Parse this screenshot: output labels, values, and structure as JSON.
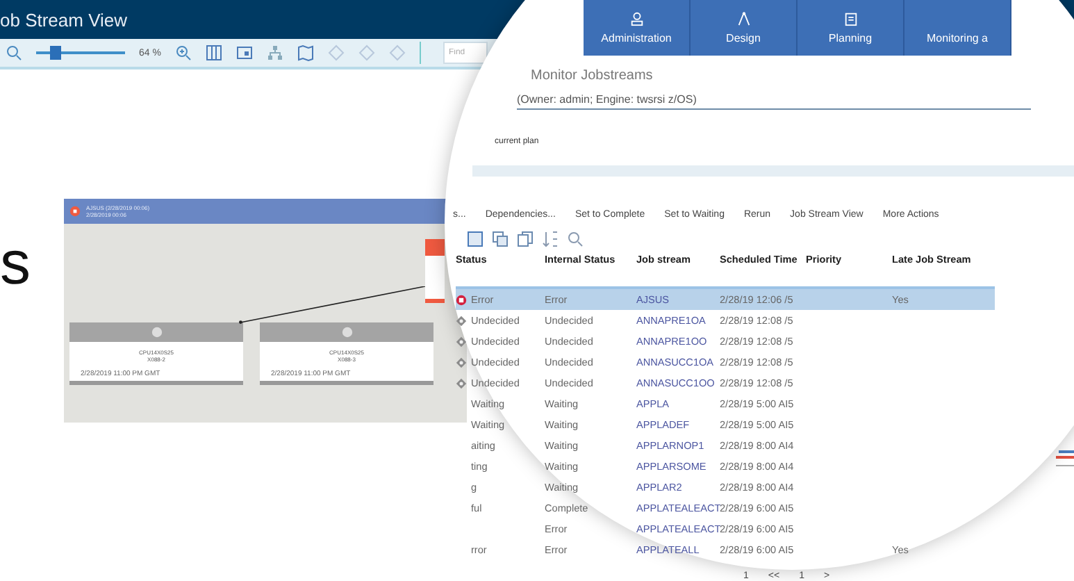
{
  "header": {
    "title": "ob Stream View"
  },
  "toolbar": {
    "zoom_reading": "64 %",
    "zoom": {
      "level": 0.22
    },
    "find": {
      "placeholder": "Find"
    }
  },
  "side_text": "s",
  "graph": {
    "title": "AJSUS (2/28/2019 00:06)",
    "subtitle": "2/28/2019 00:06",
    "nodes": [
      {
        "name": "CPU14X0S25",
        "job": "X088-2",
        "time": "2/28/2019 11:00 PM GMT"
      },
      {
        "name": "CPU14X0S25",
        "job": "X088-3",
        "time": "2/28/2019 11:00 PM GMT"
      }
    ]
  },
  "magnifier": {
    "nav_tabs": [
      {
        "label": "Administration"
      },
      {
        "label": "Design"
      },
      {
        "label": "Planning"
      },
      {
        "label": "Monitoring a"
      }
    ],
    "title": "Monitor Jobstreams",
    "subtitle": "(Owner: admin; Engine: twsrsi z/OS)",
    "plan": "current plan",
    "actions": [
      "s...",
      "Dependencies...",
      "Set to Complete",
      "Set to Waiting",
      "Rerun",
      "Job Stream View",
      "More Actions"
    ],
    "columns": [
      "Status",
      "Internal Status",
      "Job stream",
      "Scheduled Time",
      "Priority",
      "Late Job Stream"
    ],
    "rows": [
      {
        "kind": "error",
        "status": "Error",
        "internal": "Error",
        "job": "AJSUS",
        "time": "2/28/19 12:06 /5",
        "late": "Yes",
        "selected": true
      },
      {
        "kind": "undecided",
        "status": "Undecided",
        "internal": "Undecided",
        "job": "ANNAPRE1OA",
        "time": "2/28/19 12:08 /5",
        "selected": false
      },
      {
        "kind": "undecided",
        "status": "Undecided",
        "internal": "Undecided",
        "job": "ANNAPRE1OO",
        "time": "2/28/19 12:08 /5",
        "selected": false
      },
      {
        "kind": "undecided",
        "status": "Undecided",
        "internal": "Undecided",
        "job": "ANNASUCC1OA",
        "time": "2/28/19 12:08 /5",
        "selected": false
      },
      {
        "kind": "undecided",
        "status": "Undecided",
        "internal": "Undecided",
        "job": "ANNASUCC1OO",
        "time": "2/28/19 12:08 /5",
        "selected": false
      },
      {
        "kind": "plain",
        "status": "Waiting",
        "internal": "Waiting",
        "job": "APPLA",
        "time": "2/28/19 5:00 AI5",
        "selected": false
      },
      {
        "kind": "plain",
        "status": "Waiting",
        "internal": "Waiting",
        "job": "APPLADEF",
        "time": "2/28/19 5:00 AI5",
        "selected": false
      },
      {
        "kind": "plain",
        "status": "aiting",
        "internal": "Waiting",
        "job": "APPLARNOP1",
        "time": "2/28/19 8:00 AI4",
        "selected": false
      },
      {
        "kind": "plain",
        "status": "ting",
        "internal": "Waiting",
        "job": "APPLARSOME",
        "time": "2/28/19 8:00 AI4",
        "selected": false
      },
      {
        "kind": "plain",
        "status": "g",
        "internal": "Waiting",
        "job": "APPLAR2",
        "time": "2/28/19 8:00 AI4",
        "selected": false
      },
      {
        "kind": "plain",
        "status": "ful",
        "internal": "Complete",
        "job": "APPLATEALEACT",
        "time": "2/28/19 6:00 AI5",
        "selected": false
      },
      {
        "kind": "plain",
        "internal": "Error",
        "job": "APPLATEALEACT",
        "time": "2/28/19 6:00 AI5",
        "selected": false
      },
      {
        "kind": "plain",
        "status": "rror",
        "internal": "Error",
        "job": "APPLATEALL",
        "time": "2/28/19 6:00 AI5",
        "late": "Yes",
        "selected": false
      }
    ],
    "pagination": [
      "1",
      "<<",
      "1",
      ">"
    ]
  }
}
